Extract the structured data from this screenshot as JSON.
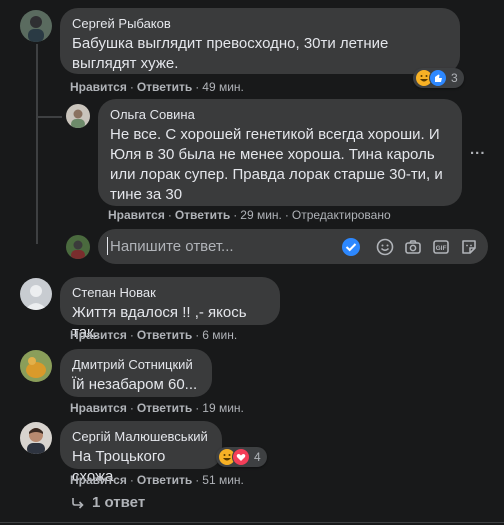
{
  "comments": [
    {
      "author": "Сергей Рыбаков",
      "text": "Бабушка выглядит превосходно, 30ти летние\nвыглядят хуже.",
      "like_label": "Нравится",
      "reply_label": "Ответить",
      "time": "49 мин.",
      "reactions": {
        "count": "3",
        "icons": [
          "laugh-emoji",
          "like-thumb"
        ]
      }
    },
    {
      "author": "Ольга Совина",
      "text": "Не все. С хорошей генетикой всегда хороши. И\nЮля в 30 была не менее хороша. Тина кароль\nили лорак супер. Правда лорак старше 30-ти, и\nтине за 30",
      "like_label": "Нравится",
      "reply_label": "Ответить",
      "time": "29 мин.",
      "edited": "Отредактировано"
    },
    {
      "author": "Степан Новак",
      "text": "Життя вдалося !! ,- якось так.",
      "like_label": "Нравится",
      "reply_label": "Ответить",
      "time": "6 мин."
    },
    {
      "author": "Дмитрий Сотницкий",
      "text": "Їй незабаром 60...",
      "like_label": "Нравится",
      "reply_label": "Ответить",
      "time": "19 мин."
    },
    {
      "author": "Сергій Малюшевський",
      "text": "На Троцького схожа",
      "like_label": "Нравится",
      "reply_label": "Ответить",
      "time": "51 мин.",
      "reactions": {
        "count": "4",
        "icons": [
          "laugh-emoji",
          "heart"
        ]
      }
    }
  ],
  "composer": {
    "placeholder": "Напишите ответ...",
    "icons": [
      "checkmark-icon",
      "emoji-icon",
      "camera-icon",
      "gif-icon",
      "sticker-icon"
    ]
  },
  "more_options": "...",
  "view_replies": "1 ответ",
  "colors": {
    "background": "#18191a",
    "bubble": "#3a3b3c",
    "text": "#e4e6eb",
    "secondary": "#b0b3b8",
    "accent": "#2d88ff"
  }
}
